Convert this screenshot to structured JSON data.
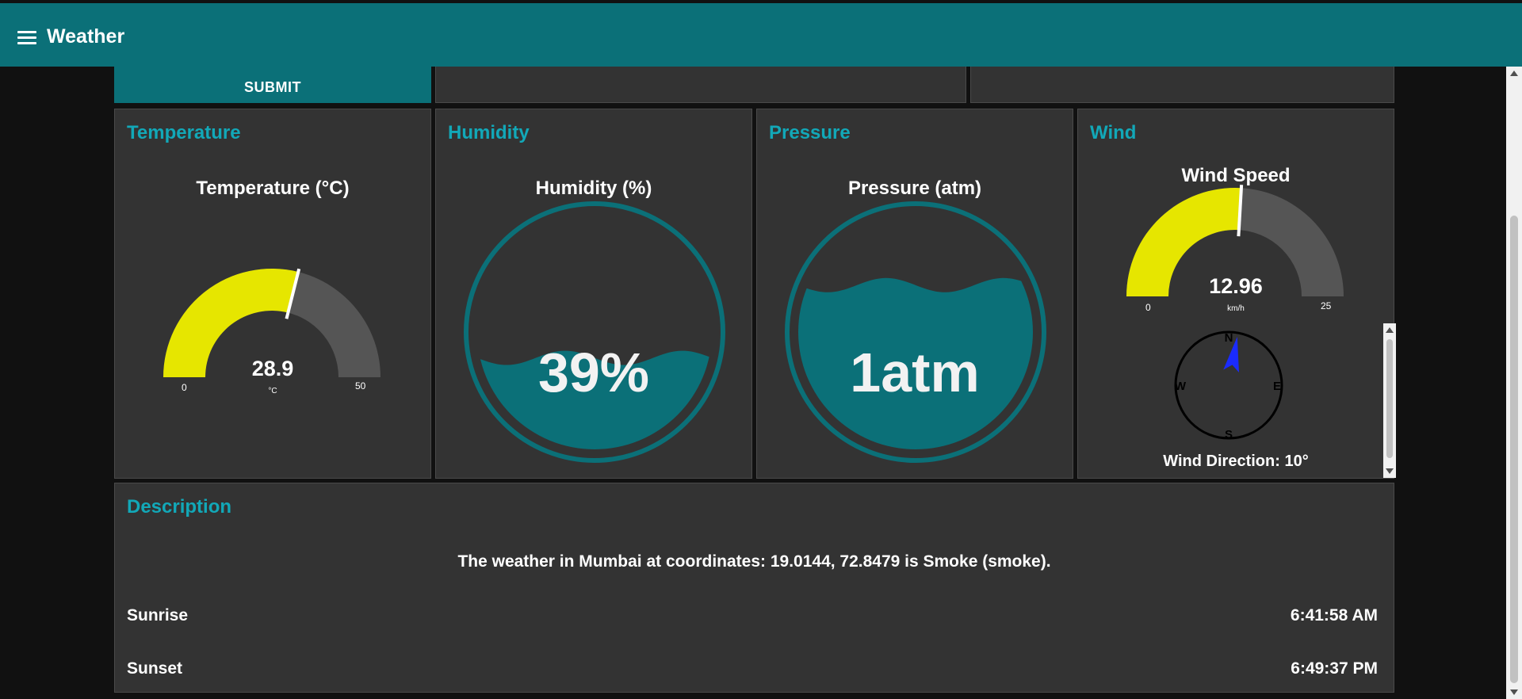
{
  "header": {
    "title": "Weather",
    "menu_icon": "hamburger-menu-icon"
  },
  "top_row": {
    "submit_label": "SUBMIT"
  },
  "temperature": {
    "card_title": "Temperature",
    "gauge_title": "Temperature (°C)",
    "value": "28.9",
    "value_num": 28.9,
    "unit": "°C",
    "min": "0",
    "max": "50"
  },
  "humidity": {
    "card_title": "Humidity",
    "gauge_title": "Humidity (%)",
    "value": "39%",
    "level": 0.39
  },
  "pressure": {
    "card_title": "Pressure",
    "gauge_title": "Pressure (atm)",
    "value": "1atm",
    "level": 0.7
  },
  "wind": {
    "card_title": "Wind",
    "speed_title": "Wind Speed",
    "speed_value": "12.96",
    "speed_num": 12.96,
    "speed_unit": "km/h",
    "speed_min": "0",
    "speed_max": "25",
    "compass": {
      "n": "N",
      "e": "E",
      "s": "S",
      "w": "W"
    },
    "direction_label": "Wind Direction: 10°",
    "direction_deg": 10
  },
  "description": {
    "card_title": "Description",
    "text": "The weather in Mumbai at coordinates: 19.0144, 72.8479 is Smoke (smoke).",
    "sunrise_label": "Sunrise",
    "sunrise_value": "6:41:58 AM",
    "sunset_label": "Sunset",
    "sunset_value": "6:49:37 PM"
  },
  "colors": {
    "accent": "#0b7078",
    "title_accent": "#12a8b8",
    "gauge_fill": "#e6e600",
    "gauge_track": "#555555",
    "card_bg": "#333333",
    "page_bg": "#111111"
  }
}
